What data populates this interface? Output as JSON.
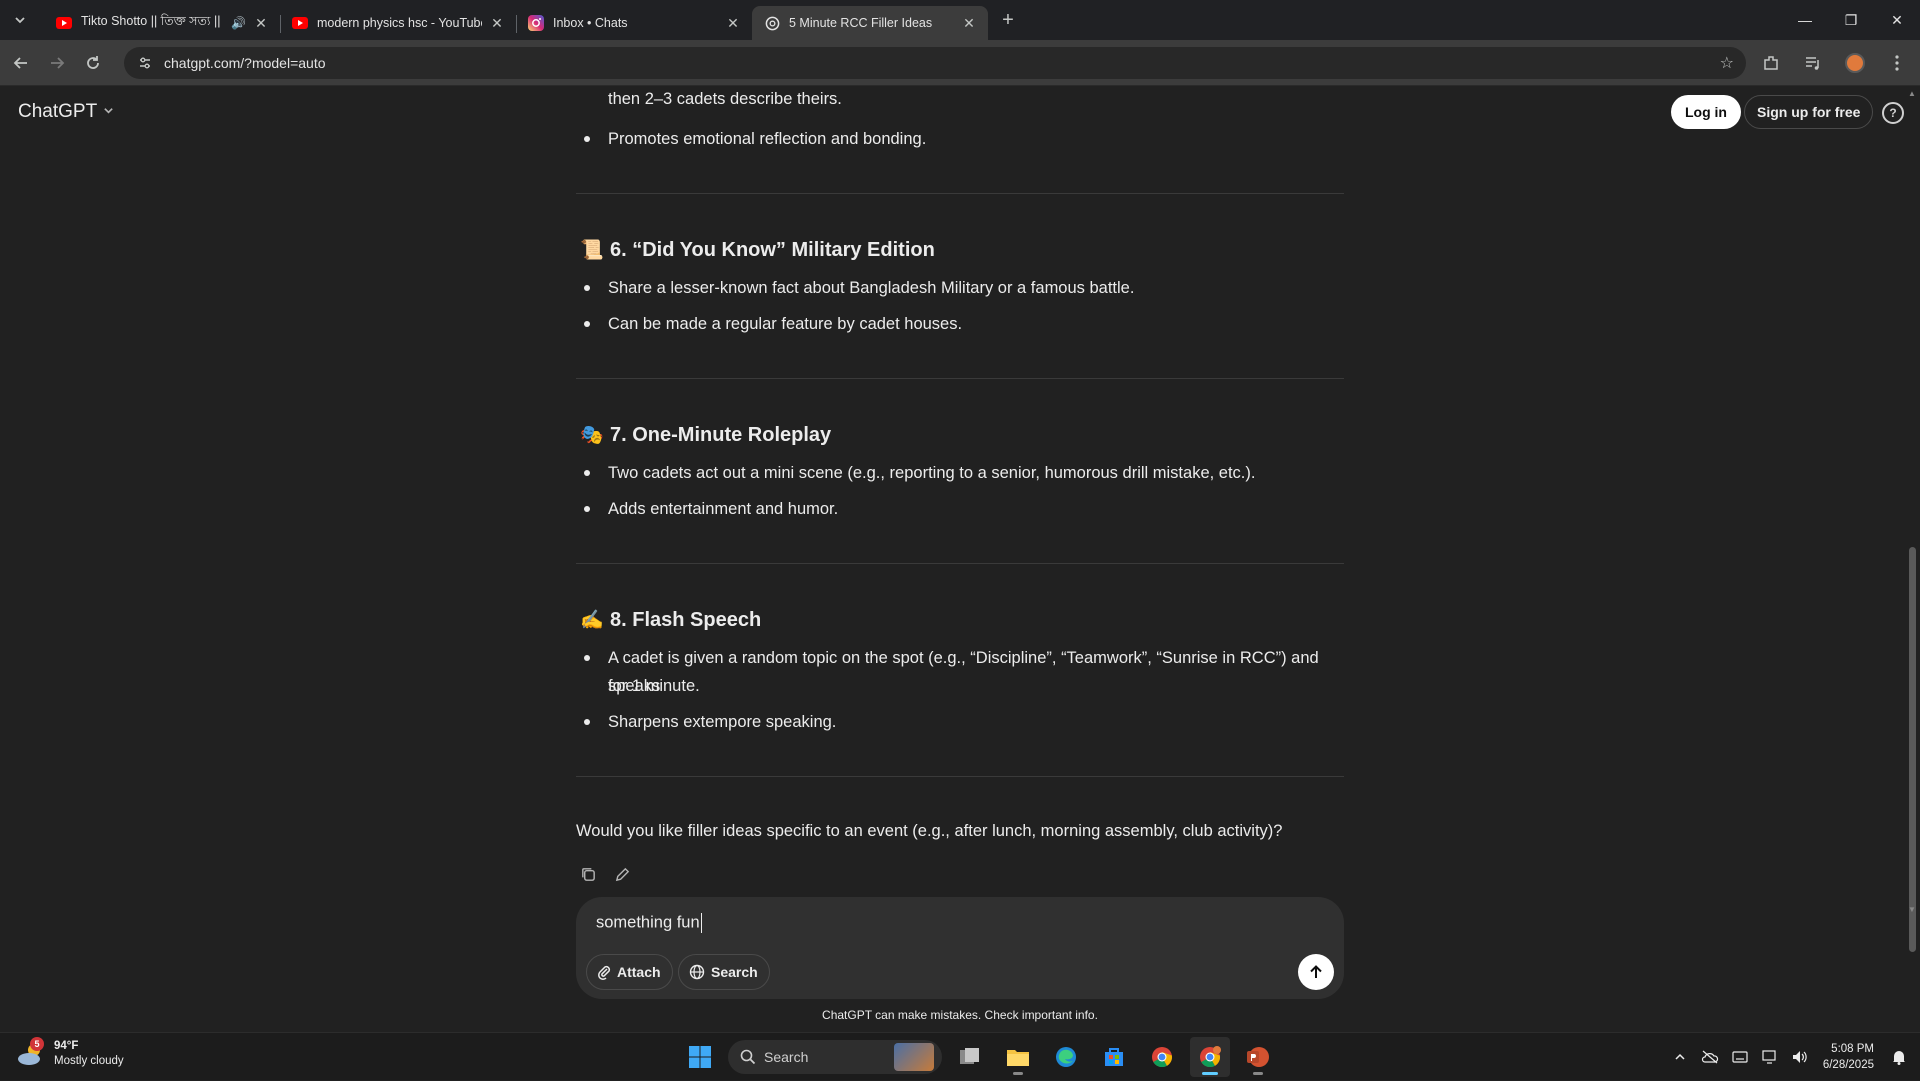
{
  "browser": {
    "tabs": [
      {
        "title": "Tikto Shotto || তিক্ত সত্য || P",
        "favicon": "youtube-icon",
        "audio": true,
        "active": false
      },
      {
        "title": "modern physics hsc - YouTube",
        "favicon": "youtube-icon",
        "audio": false,
        "active": false
      },
      {
        "title": "Inbox • Chats",
        "favicon": "instagram-icon",
        "audio": false,
        "active": false
      },
      {
        "title": "5 Minute RCC Filler Ideas",
        "favicon": "chatgpt-icon",
        "audio": false,
        "active": true
      }
    ],
    "url": "chatgpt.com/?model=auto"
  },
  "header": {
    "brand": "ChatGPT",
    "login": "Log in",
    "signup": "Sign up for free",
    "help": "?"
  },
  "conversation": {
    "prev_tail": "then 2–3 cadets describe theirs.",
    "prev_bullet": "Promotes emotional reflection and bonding.",
    "sections": [
      {
        "emoji": "📜",
        "title": "6. “Did You Know” Military Edition",
        "bullets": [
          "Share a lesser-known fact about Bangladesh Military or a famous battle.",
          "Can be made a regular feature by cadet houses."
        ]
      },
      {
        "emoji": "🎭",
        "title": "7. One-Minute Roleplay",
        "bullets": [
          "Two cadets act out a mini scene (e.g., reporting to a senior, humorous drill mistake, etc.).",
          "Adds entertainment and humor."
        ]
      },
      {
        "emoji": "✍️",
        "title": "8. Flash Speech",
        "bullets": [
          "A cadet is given a random topic on the spot (e.g., “Discipline”, “Teamwork”, “Sunrise in RCC”) and speaks",
          "for 1 minute.",
          "Sharpens extempore speaking."
        ]
      }
    ],
    "closing_question": "Would you like filler ideas specific to an event (e.g., after lunch, morning assembly, club activity)?"
  },
  "composer": {
    "value": "something fun",
    "attach": "Attach",
    "search": "Search"
  },
  "disclaimer": "ChatGPT can make mistakes. Check important info.",
  "taskbar": {
    "weather_badge": "5",
    "temperature": "94°F",
    "condition": "Mostly cloudy",
    "search_label": "Search",
    "time": "5:08 PM",
    "date": "6/28/2025"
  },
  "colors": {
    "background": "#212121",
    "youtube": "#ff0000",
    "accent_taskbar": "#60cdff"
  }
}
